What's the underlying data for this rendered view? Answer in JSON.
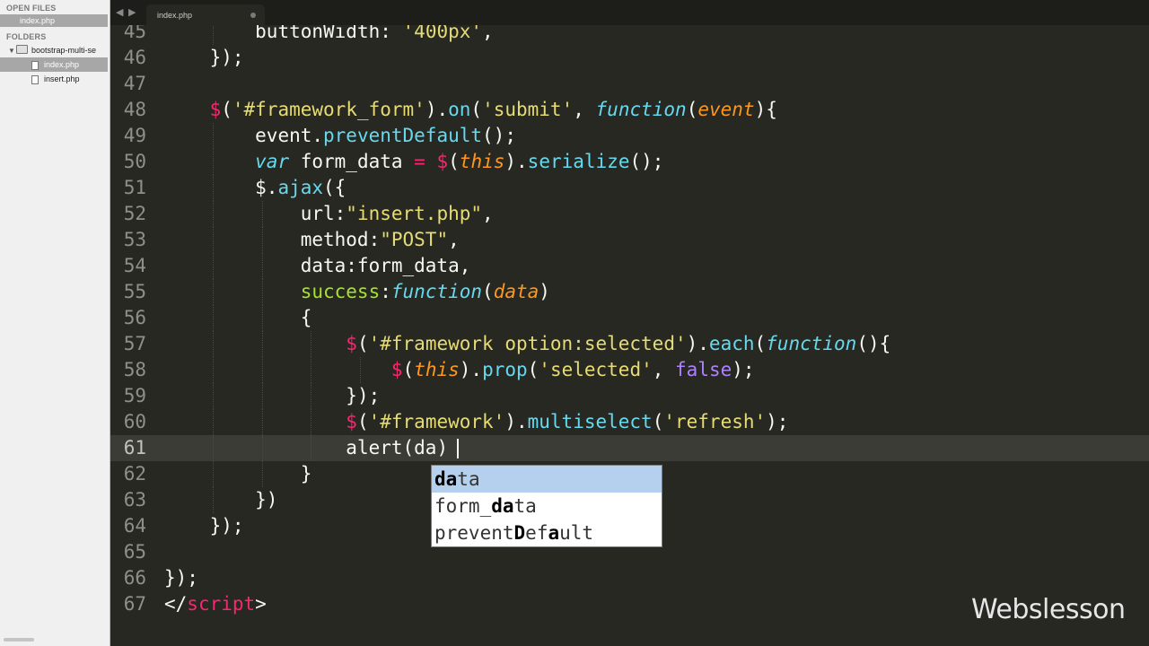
{
  "sidebar": {
    "open_files_title": "OPEN FILES",
    "open_files": [
      {
        "label": "index.php"
      }
    ],
    "folders_title": "FOLDERS",
    "folder": {
      "label": "bootstrap-multi-se"
    },
    "files": [
      {
        "label": "index.php",
        "active": true
      },
      {
        "label": "insert.php",
        "active": false
      }
    ]
  },
  "tabs": [
    {
      "label": "index.php",
      "dirty": true
    }
  ],
  "editor": {
    "current_line": 61,
    "lines": [
      {
        "n": "45",
        "indent": 2,
        "t": [
          [
            "w",
            "buttonWidth:"
          ],
          [
            "w",
            " "
          ],
          [
            "s",
            "'400px'"
          ],
          [
            "w",
            ","
          ]
        ]
      },
      {
        "n": "46",
        "indent": 1,
        "t": [
          [
            "w",
            "});"
          ]
        ]
      },
      {
        "n": "47",
        "indent": 0,
        "t": []
      },
      {
        "n": "48",
        "indent": 1,
        "t": [
          [
            "kw",
            "$"
          ],
          [
            "w",
            "("
          ],
          [
            "s",
            "'#framework_form'"
          ],
          [
            "w",
            ")."
          ],
          [
            "fn",
            "on"
          ],
          [
            "w",
            "("
          ],
          [
            "s",
            "'submit'"
          ],
          [
            "w",
            ", "
          ],
          [
            "k",
            "function"
          ],
          [
            "w",
            "("
          ],
          [
            "p",
            "event"
          ],
          [
            "w",
            "){"
          ]
        ]
      },
      {
        "n": "49",
        "indent": 2,
        "t": [
          [
            "w",
            "event."
          ],
          [
            "fn",
            "preventDefault"
          ],
          [
            "w",
            "();"
          ]
        ]
      },
      {
        "n": "50",
        "indent": 2,
        "t": [
          [
            "k",
            "var"
          ],
          [
            "w",
            " form_data "
          ],
          [
            "kw",
            "="
          ],
          [
            "w",
            " "
          ],
          [
            "kw",
            "$"
          ],
          [
            "w",
            "("
          ],
          [
            "p",
            "this"
          ],
          [
            "w",
            ")."
          ],
          [
            "fn",
            "serialize"
          ],
          [
            "w",
            "();"
          ]
        ]
      },
      {
        "n": "51",
        "indent": 2,
        "t": [
          [
            "w",
            "$."
          ],
          [
            "fn",
            "ajax"
          ],
          [
            "w",
            "({"
          ]
        ]
      },
      {
        "n": "52",
        "indent": 3,
        "t": [
          [
            "w",
            "url:"
          ],
          [
            "s",
            "\"insert.php\""
          ],
          [
            "w",
            ","
          ]
        ]
      },
      {
        "n": "53",
        "indent": 3,
        "t": [
          [
            "w",
            "method:"
          ],
          [
            "s",
            "\"POST\""
          ],
          [
            "w",
            ","
          ]
        ]
      },
      {
        "n": "54",
        "indent": 3,
        "t": [
          [
            "w",
            "data:form_data,"
          ]
        ]
      },
      {
        "n": "55",
        "indent": 3,
        "t": [
          [
            "g",
            "success"
          ],
          [
            "w",
            ":"
          ],
          [
            "k",
            "function"
          ],
          [
            "w",
            "("
          ],
          [
            "p",
            "data"
          ],
          [
            "w",
            ")"
          ]
        ]
      },
      {
        "n": "56",
        "indent": 3,
        "t": [
          [
            "w",
            "{"
          ]
        ]
      },
      {
        "n": "57",
        "indent": 4,
        "t": [
          [
            "kw",
            "$"
          ],
          [
            "w",
            "("
          ],
          [
            "s",
            "'#framework option:selected'"
          ],
          [
            "w",
            ")."
          ],
          [
            "fn",
            "each"
          ],
          [
            "w",
            "("
          ],
          [
            "k",
            "function"
          ],
          [
            "w",
            "(){"
          ]
        ]
      },
      {
        "n": "58",
        "indent": 5,
        "t": [
          [
            "kw",
            "$"
          ],
          [
            "w",
            "("
          ],
          [
            "p",
            "this"
          ],
          [
            "w",
            ")."
          ],
          [
            "fn",
            "prop"
          ],
          [
            "w",
            "("
          ],
          [
            "s",
            "'selected'"
          ],
          [
            "w",
            ", "
          ],
          [
            "n",
            "false"
          ],
          [
            "w",
            ");"
          ]
        ]
      },
      {
        "n": "59",
        "indent": 4,
        "t": [
          [
            "w",
            "});"
          ]
        ]
      },
      {
        "n": "60",
        "indent": 4,
        "t": [
          [
            "kw",
            "$"
          ],
          [
            "w",
            "("
          ],
          [
            "s",
            "'#framework'"
          ],
          [
            "w",
            ")."
          ],
          [
            "fn",
            "multiselect"
          ],
          [
            "w",
            "("
          ],
          [
            "s",
            "'refresh'"
          ],
          [
            "w",
            ");"
          ]
        ]
      },
      {
        "n": "61",
        "indent": 4,
        "t": [
          [
            "w",
            "alert(da)"
          ]
        ]
      },
      {
        "n": "62",
        "indent": 3,
        "t": [
          [
            "w",
            "}"
          ]
        ]
      },
      {
        "n": "63",
        "indent": 2,
        "t": [
          [
            "w",
            "})"
          ]
        ]
      },
      {
        "n": "64",
        "indent": 1,
        "t": [
          [
            "w",
            "});"
          ]
        ]
      },
      {
        "n": "65",
        "indent": 0,
        "t": []
      },
      {
        "n": "66",
        "indent": 0,
        "t": [
          [
            "w",
            "});"
          ]
        ]
      },
      {
        "n": "67",
        "indent": 0,
        "t": [
          [
            "w",
            "</"
          ],
          [
            "kw",
            "script"
          ],
          [
            "w",
            ">"
          ]
        ]
      }
    ]
  },
  "autocomplete": {
    "items": [
      {
        "parts": [
          [
            "b",
            "da"
          ],
          [
            "n",
            "ta"
          ]
        ],
        "selected": true
      },
      {
        "parts": [
          [
            "n",
            "form_"
          ],
          [
            "b",
            "da"
          ],
          [
            "n",
            "ta"
          ]
        ],
        "selected": false
      },
      {
        "parts": [
          [
            "n",
            "prevent"
          ],
          [
            "b",
            "D"
          ],
          [
            "n",
            "ef"
          ],
          [
            "b",
            "a"
          ],
          [
            "n",
            "ult"
          ]
        ],
        "selected": false
      }
    ]
  },
  "watermark": "Webslesson",
  "colors": {
    "background": "#272822",
    "keyword": "#66d9ef",
    "string": "#e6db74",
    "operator": "#f92672",
    "parameter": "#fd971f",
    "constant": "#ae81ff",
    "property": "#a6e22e"
  }
}
